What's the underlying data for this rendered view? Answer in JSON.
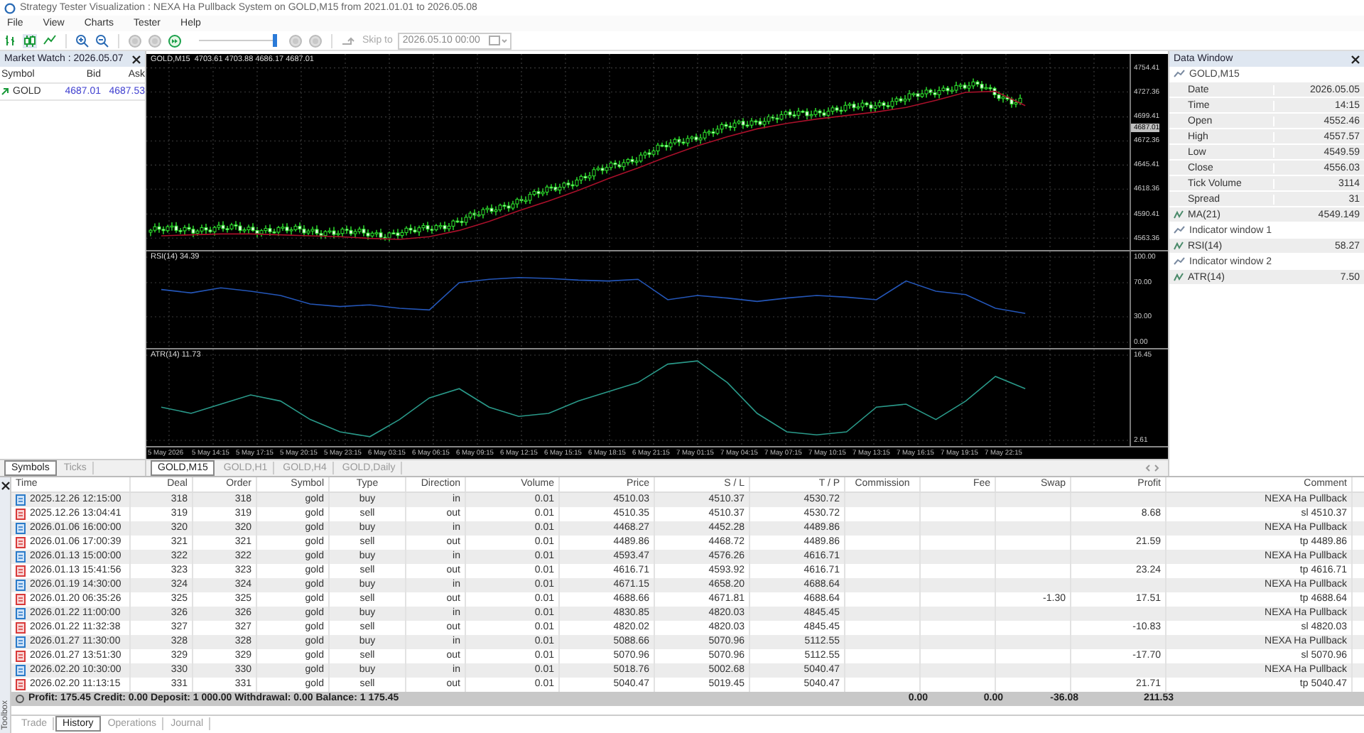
{
  "window": {
    "title": "Strategy Tester Visualization : NEXA Ha Pullback System on GOLD,M15 from 2021.01.01 to 2026.05.08"
  },
  "menu": [
    "File",
    "View",
    "Charts",
    "Tester",
    "Help"
  ],
  "toolbar": {
    "speed_slider": {
      "level": 1
    },
    "skip_label": "Skip to",
    "skip_date": "2026.05.10 00:00"
  },
  "market_watch": {
    "title": "Market Watch : 2026.05.07",
    "columns": [
      "Symbol",
      "Bid",
      "Ask"
    ],
    "rows": [
      {
        "symbol": "GOLD",
        "bid": "4687.01",
        "ask": "4687.53"
      }
    ],
    "tabs": [
      {
        "label": "Symbols",
        "selected": true
      },
      {
        "label": "Ticks",
        "selected": false
      }
    ]
  },
  "chart": {
    "header": "GOLD,M15  4703.61 4703.88 4686.17 4687.01",
    "current_price": "4687.01",
    "chart_data": {
      "type": "line",
      "grid": true,
      "ylim": [
        4550,
        4770
      ],
      "yticks": [
        {
          "value": 4754.41,
          "label": "4754.41"
        },
        {
          "value": 4727.36,
          "label": "4727.36"
        },
        {
          "value": 4699.41,
          "label": "4699.41"
        },
        {
          "value": 4672.36,
          "label": "4672.36"
        },
        {
          "value": 4645.41,
          "label": "4645.41"
        },
        {
          "value": 4618.36,
          "label": "4618.36"
        },
        {
          "value": 4590.41,
          "label": "4590.41"
        },
        {
          "value": 4563.36,
          "label": "4563.36"
        }
      ],
      "series": [
        {
          "color": "#a8102a",
          "values": [
            4566,
            4567,
            4568,
            4568,
            4567,
            4566,
            4565,
            4563,
            4562,
            4565,
            4572,
            4582,
            4594,
            4605,
            4617,
            4630,
            4642,
            4655,
            4667,
            4677,
            4686,
            4692,
            4697,
            4701,
            4705,
            4710,
            4718,
            4727,
            4728,
            4712,
            null,
            null,
            null
          ]
        }
      ]
    },
    "rsi": {
      "label": "RSI(14) 34.39",
      "chart_data": {
        "type": "line",
        "grid": true,
        "ylim": [
          0,
          100
        ],
        "yticks": [
          {
            "value": 100,
            "label": "100.00"
          },
          {
            "value": 70,
            "label": "70.00"
          },
          {
            "value": 30,
            "label": "30.00"
          },
          {
            "value": 0,
            "label": "0.00"
          }
        ],
        "series": [
          {
            "color": "#2456b8",
            "values": [
              62,
              58,
              64,
              60,
              55,
              45,
              42,
              44,
              40,
              38,
              70,
              74,
              76,
              75,
              73,
              72,
              74,
              50,
              55,
              52,
              48,
              52,
              55,
              53,
              50,
              72,
              60,
              56,
              40,
              34,
              null,
              null,
              null
            ]
          }
        ]
      }
    },
    "atr": {
      "label": "ATR(14) 11.73",
      "chart_data": {
        "type": "line",
        "grid": true,
        "ylim": [
          2.61,
          16.45
        ],
        "yticks": [
          {
            "value": 16.45,
            "label": "16.45"
          },
          {
            "value": 2.61,
            "label": "2.61"
          }
        ],
        "series": [
          {
            "color": "#2a9a8a",
            "values": [
              8,
              7,
              8.5,
              10,
              9,
              6,
              4,
              3.2,
              6,
              9.5,
              11,
              8,
              6.5,
              7,
              9,
              10.5,
              12,
              15,
              15.5,
              12,
              7,
              4,
              3.5,
              4,
              8,
              8.5,
              6,
              9,
              13,
              11,
              null,
              null,
              null
            ]
          }
        ]
      }
    },
    "time_axis": [
      "5 May 2026",
      "5 May 14:15",
      "5 May 17:15",
      "5 May 20:15",
      "5 May 23:15",
      "6 May 03:15",
      "6 May 06:15",
      "6 May 09:15",
      "6 May 12:15",
      "6 May 15:15",
      "6 May 18:15",
      "6 May 21:15",
      "7 May 01:15",
      "7 May 04:15",
      "7 May 07:15",
      "7 May 10:15",
      "7 May 13:15",
      "7 May 16:15",
      "7 May 19:15",
      "7 May 22:15"
    ],
    "tabs": [
      {
        "label": "GOLD,M15",
        "selected": true
      },
      {
        "label": "GOLD,H1",
        "selected": false
      },
      {
        "label": "GOLD,H4",
        "selected": false
      },
      {
        "label": "GOLD,Daily",
        "selected": false
      }
    ]
  },
  "data_window": {
    "title": "Data Window",
    "rows": [
      {
        "kind": "group",
        "label": "GOLD,M15"
      },
      {
        "kind": "field",
        "label": "Date",
        "value": "2026.05.05"
      },
      {
        "kind": "field",
        "label": "Time",
        "value": "14:15"
      },
      {
        "kind": "field",
        "label": "Open",
        "value": "4552.46"
      },
      {
        "kind": "field",
        "label": "High",
        "value": "4557.57"
      },
      {
        "kind": "field",
        "label": "Low",
        "value": "4549.59"
      },
      {
        "kind": "field",
        "label": "Close",
        "value": "4556.03"
      },
      {
        "kind": "field",
        "label": "Tick Volume",
        "value": "3114"
      },
      {
        "kind": "field",
        "label": "Spread",
        "value": "31"
      },
      {
        "kind": "indicator",
        "label": "MA(21)",
        "value": "4549.149"
      },
      {
        "kind": "group",
        "label": "Indicator window 1"
      },
      {
        "kind": "indicator",
        "label": "RSI(14)",
        "value": "58.27"
      },
      {
        "kind": "group",
        "label": "Indicator window 2"
      },
      {
        "kind": "indicator",
        "label": "ATR(14)",
        "value": "7.50"
      }
    ]
  },
  "toolbox": {
    "label": "Toolbox",
    "columns": [
      "Time",
      "Deal",
      "Order",
      "Symbol",
      "Type",
      "Direction",
      "Volume",
      "Price",
      "S / L",
      "T / P",
      "Commission",
      "Fee",
      "Swap",
      "Profit",
      "Comment"
    ],
    "rows": [
      {
        "kind": "in",
        "time": "2025.12.26 12:15:00",
        "deal": "318",
        "order": "318",
        "symbol": "gold",
        "type": "buy",
        "direction": "in",
        "volume": "0.01",
        "price": "4510.03",
        "sl": "4510.37",
        "tp": "4530.72",
        "comment": "NEXA Ha Pullback"
      },
      {
        "kind": "out",
        "time": "2025.12.26 13:04:41",
        "deal": "319",
        "order": "319",
        "symbol": "gold",
        "type": "sell",
        "direction": "out",
        "volume": "0.01",
        "price": "4510.35",
        "sl": "4510.37",
        "tp": "4530.72",
        "profit": "8.68",
        "comment": "sl 4510.37"
      },
      {
        "kind": "in",
        "time": "2026.01.06 16:00:00",
        "deal": "320",
        "order": "320",
        "symbol": "gold",
        "type": "buy",
        "direction": "in",
        "volume": "0.01",
        "price": "4468.27",
        "sl": "4452.28",
        "tp": "4489.86",
        "comment": "NEXA Ha Pullback"
      },
      {
        "kind": "out",
        "time": "2026.01.06 17:00:39",
        "deal": "321",
        "order": "321",
        "symbol": "gold",
        "type": "sell",
        "direction": "out",
        "volume": "0.01",
        "price": "4489.86",
        "sl": "4468.72",
        "tp": "4489.86",
        "profit": "21.59",
        "comment": "tp 4489.86"
      },
      {
        "kind": "in",
        "time": "2026.01.13 15:00:00",
        "deal": "322",
        "order": "322",
        "symbol": "gold",
        "type": "buy",
        "direction": "in",
        "volume": "0.01",
        "price": "4593.47",
        "sl": "4576.26",
        "tp": "4616.71",
        "comment": "NEXA Ha Pullback"
      },
      {
        "kind": "out",
        "time": "2026.01.13 15:41:56",
        "deal": "323",
        "order": "323",
        "symbol": "gold",
        "type": "sell",
        "direction": "out",
        "volume": "0.01",
        "price": "4616.71",
        "sl": "4593.92",
        "tp": "4616.71",
        "profit": "23.24",
        "comment": "tp 4616.71"
      },
      {
        "kind": "in",
        "time": "2026.01.19 14:30:00",
        "deal": "324",
        "order": "324",
        "symbol": "gold",
        "type": "buy",
        "direction": "in",
        "volume": "0.01",
        "price": "4671.15",
        "sl": "4658.20",
        "tp": "4688.64",
        "comment": "NEXA Ha Pullback"
      },
      {
        "kind": "out",
        "time": "2026.01.20 06:35:26",
        "deal": "325",
        "order": "325",
        "symbol": "gold",
        "type": "sell",
        "direction": "out",
        "volume": "0.01",
        "price": "4688.66",
        "sl": "4671.81",
        "tp": "4688.64",
        "swap": "-1.30",
        "profit": "17.51",
        "comment": "tp 4688.64"
      },
      {
        "kind": "in",
        "time": "2026.01.22 11:00:00",
        "deal": "326",
        "order": "326",
        "symbol": "gold",
        "type": "buy",
        "direction": "in",
        "volume": "0.01",
        "price": "4830.85",
        "sl": "4820.03",
        "tp": "4845.45",
        "comment": "NEXA Ha Pullback"
      },
      {
        "kind": "out",
        "time": "2026.01.22 11:32:38",
        "deal": "327",
        "order": "327",
        "symbol": "gold",
        "type": "sell",
        "direction": "out",
        "volume": "0.01",
        "price": "4820.02",
        "sl": "4820.03",
        "tp": "4845.45",
        "profit": "-10.83",
        "comment": "sl 4820.03"
      },
      {
        "kind": "in",
        "time": "2026.01.27 11:30:00",
        "deal": "328",
        "order": "328",
        "symbol": "gold",
        "type": "buy",
        "direction": "in",
        "volume": "0.01",
        "price": "5088.66",
        "sl": "5070.96",
        "tp": "5112.55",
        "comment": "NEXA Ha Pullback"
      },
      {
        "kind": "out",
        "time": "2026.01.27 13:51:30",
        "deal": "329",
        "order": "329",
        "symbol": "gold",
        "type": "sell",
        "direction": "out",
        "volume": "0.01",
        "price": "5070.96",
        "sl": "5070.96",
        "tp": "5112.55",
        "profit": "-17.70",
        "comment": "sl 5070.96"
      },
      {
        "kind": "in",
        "time": "2026.02.20 10:30:00",
        "deal": "330",
        "order": "330",
        "symbol": "gold",
        "type": "buy",
        "direction": "in",
        "volume": "0.01",
        "price": "5018.76",
        "sl": "5002.68",
        "tp": "5040.47",
        "comment": "NEXA Ha Pullback"
      },
      {
        "kind": "out",
        "time": "2026.02.20 11:13:15",
        "deal": "331",
        "order": "331",
        "symbol": "gold",
        "type": "sell",
        "direction": "out",
        "volume": "0.01",
        "price": "5040.47",
        "sl": "5019.45",
        "tp": "5040.47",
        "profit": "21.71",
        "comment": "tp 5040.47"
      }
    ],
    "totals": {
      "summary": "Profit: 175.45  Credit: 0.00  Deposit: 1 000.00  Withdrawal: 0.00  Balance: 1 175.45",
      "commission": "0.00",
      "fee": "0.00",
      "swap": "-36.08",
      "profit": "211.53"
    },
    "tabs": [
      {
        "label": "Trade",
        "selected": false
      },
      {
        "label": "History",
        "selected": true
      },
      {
        "label": "Operations",
        "selected": false
      },
      {
        "label": "Journal",
        "selected": false
      }
    ]
  }
}
